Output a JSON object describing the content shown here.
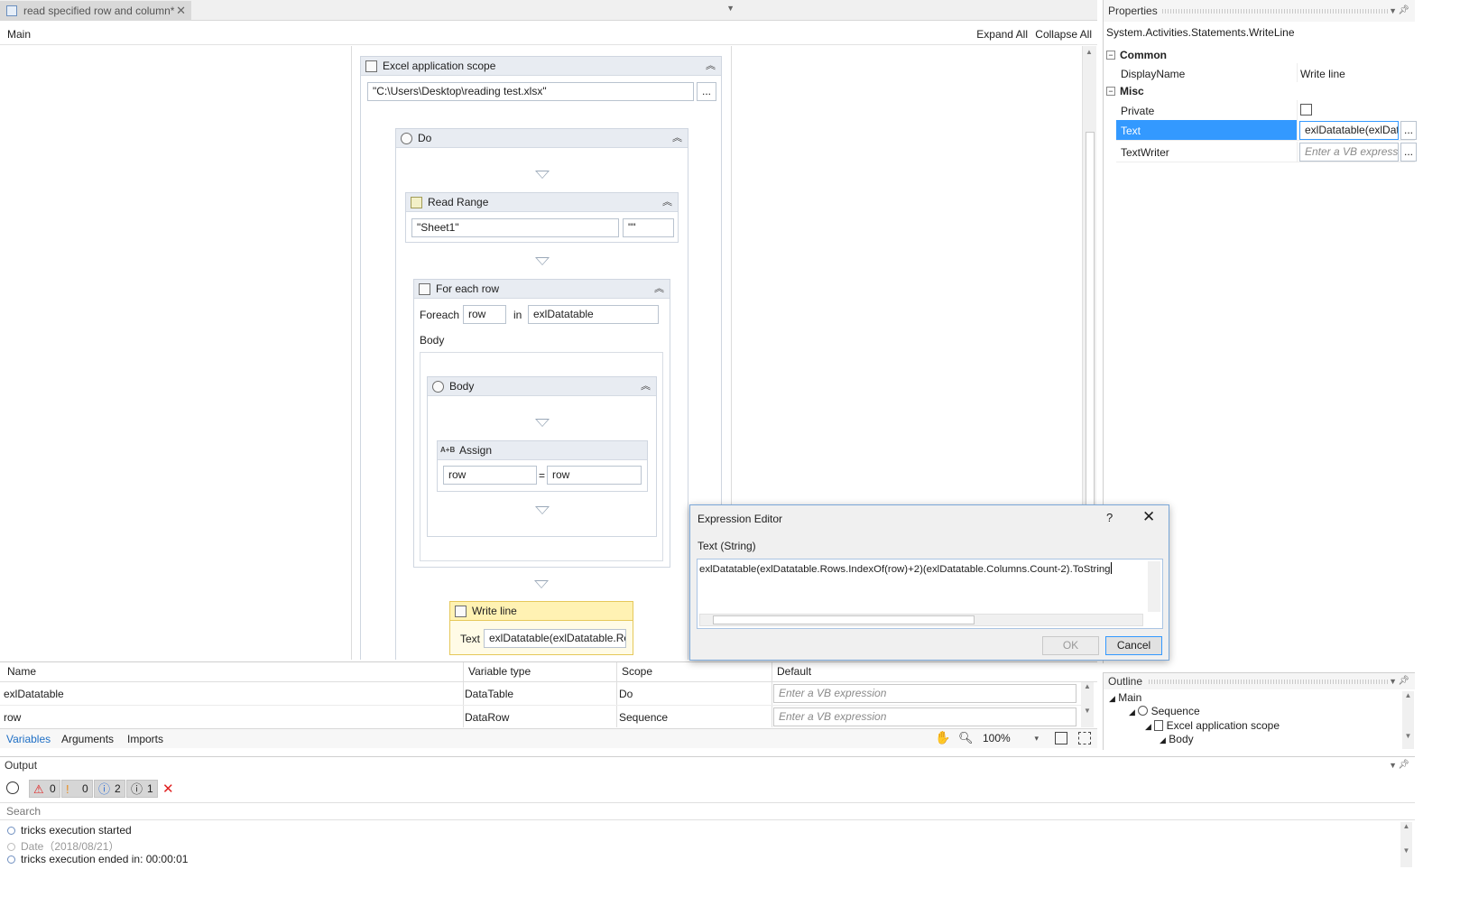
{
  "tab": {
    "title": "read specified row and column*",
    "close": "✕"
  },
  "breadcrumb": {
    "label": "Main",
    "expand_all": "Expand All",
    "collapse_all": "Collapse All"
  },
  "workflow": {
    "excel_scope": {
      "title": "Excel application scope",
      "path": "\"C:\\Users\\Desktop\\reading test.xlsx\"",
      "browse": "..."
    },
    "do": {
      "title": "Do"
    },
    "read_range": {
      "title": "Read Range",
      "sheet": "\"Sheet1\"",
      "range": "\"\""
    },
    "for_each_row": {
      "title": "For each row",
      "foreach_label": "Foreach",
      "item": "row",
      "in_label": "in",
      "collection": "exlDatatable",
      "body_label": "Body"
    },
    "body": {
      "title": "Body"
    },
    "assign": {
      "title": "Assign",
      "to": "row",
      "eq": "=",
      "value": "row",
      "icon_text": "A+B"
    },
    "write_line": {
      "title": "Write line",
      "text_label": "Text",
      "text_value": "exlDatatable(exlDatatable.Rov"
    }
  },
  "variables": {
    "headers": {
      "name": "Name",
      "type": "Variable type",
      "scope": "Scope",
      "default": "Default"
    },
    "rows": [
      {
        "name": "exlDatatable",
        "type": "DataTable",
        "scope": "Do",
        "default_placeholder": "Enter a VB expression"
      },
      {
        "name": "row",
        "type": "DataRow",
        "scope": "Sequence",
        "default_placeholder": "Enter a VB expression"
      }
    ],
    "tabs": [
      "Variables",
      "Arguments",
      "Imports"
    ],
    "zoom": "100%"
  },
  "properties": {
    "title": "Properties",
    "type_name": "System.Activities.Statements.WriteLine",
    "categories": {
      "common": "Common",
      "misc": "Misc"
    },
    "rows": {
      "display_name": {
        "key": "DisplayName",
        "value": "Write line"
      },
      "private": {
        "key": "Private"
      },
      "text": {
        "key": "Text",
        "value": "exlDatatable(exlData"
      },
      "text_writer": {
        "key": "TextWriter",
        "placeholder": "Enter a VB expressic"
      }
    },
    "ellipsis": "..."
  },
  "outline": {
    "title": "Outline",
    "items": [
      "Main",
      "Sequence",
      "Excel application scope",
      "Body"
    ]
  },
  "output": {
    "title": "Output",
    "badges": {
      "errors": "0",
      "warnings": "0",
      "info": "2",
      "trace": "1"
    },
    "search_placeholder": "Search",
    "lines": [
      "tricks execution started",
      "Date（2018/08/21）",
      "tricks execution ended in: 00:00:01"
    ]
  },
  "expression_editor": {
    "title": "Expression Editor",
    "help": "?",
    "close": "✕",
    "label": "Text (String)",
    "expression": "exlDatatable(exlDatatable.Rows.IndexOf(row)+2)(exlDatatable.Columns.Count-2).ToString",
    "ok": "OK",
    "cancel": "Cancel"
  },
  "colors": {
    "accent": "#3399ff",
    "selected_row": "#3399ff",
    "write_line_header": "#fff2b3",
    "error": "#e02020",
    "warning": "#e88a1a",
    "info": "#2f6fd6"
  }
}
